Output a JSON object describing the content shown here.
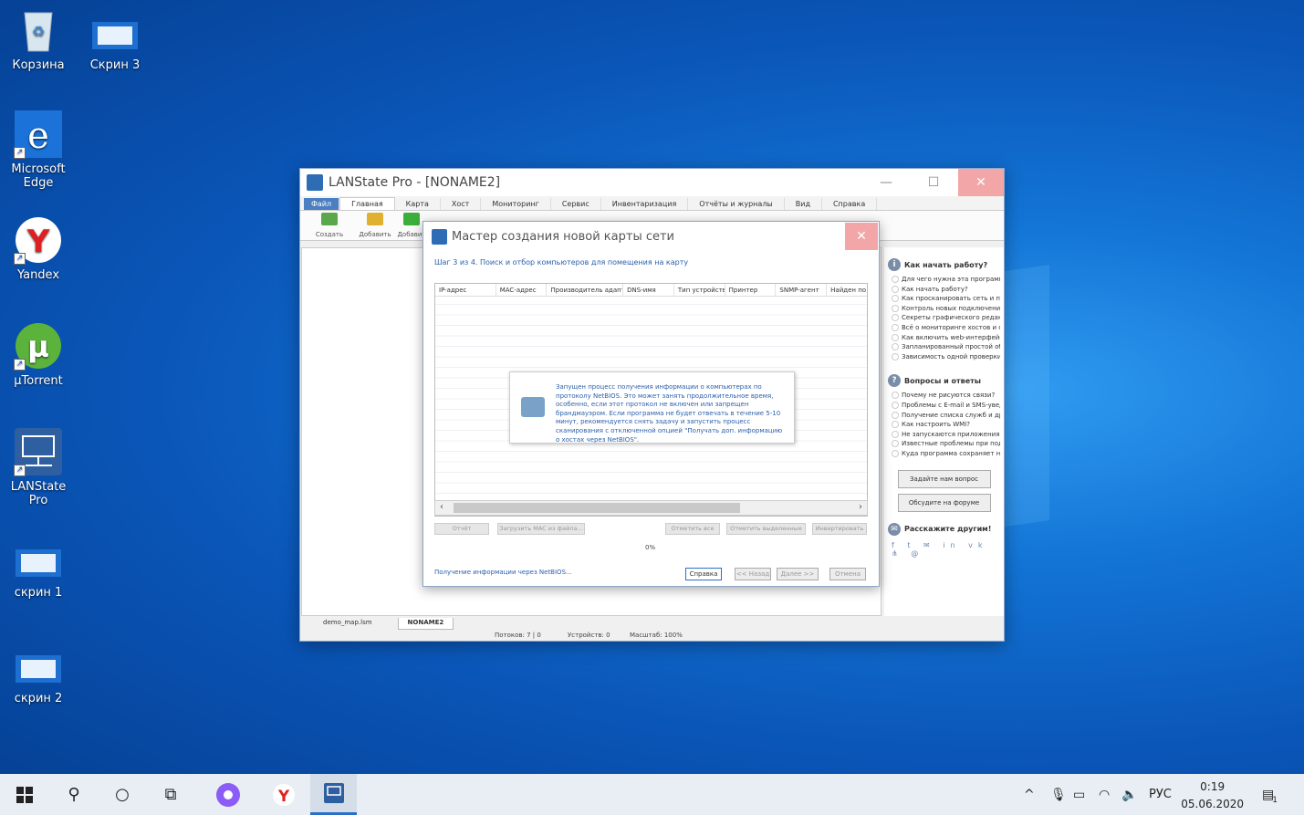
{
  "desktop": {
    "icons": [
      {
        "label": "Корзина",
        "icon": "recycle-bin-icon"
      },
      {
        "label": "Скрин 3",
        "icon": "image-file-icon"
      },
      {
        "label": "Microsoft Edge",
        "icon": "edge-icon"
      },
      {
        "label": "Yandex",
        "icon": "yandex-browser-icon"
      },
      {
        "label": "µTorrent",
        "icon": "utorrent-icon"
      },
      {
        "label": "LANState Pro",
        "icon": "lanstate-icon"
      },
      {
        "label": "скрин 1",
        "icon": "image-file-icon"
      },
      {
        "label": "скрин 2",
        "icon": "image-file-icon"
      }
    ]
  },
  "window": {
    "title": "LANState Pro - [NONAME2]",
    "menu": [
      "Файл",
      "Главная",
      "Карта",
      "Хост",
      "Мониторинг",
      "Сервис",
      "Инвентаризация",
      "Отчёты и журналы",
      "Вид",
      "Справка"
    ],
    "ribbon": [
      "Создать",
      "Добавить",
      "Добавит"
    ],
    "bottom_tabs": [
      "demo_map.lsm",
      "NONAME2"
    ],
    "status": {
      "threads": "Потоков: 7 | 0",
      "devices": "Устройств: 0",
      "scale": "Масштаб: 100%"
    }
  },
  "help": {
    "start_title": "Как начать работу?",
    "start_items": [
      "Для чего нужна эта программа?",
      "Как начать работу?",
      "Как просканировать сеть и постр...",
      "Контроль новых подключений к ...",
      "Секреты графического редактора",
      "Всё о мониторинге хостов и опов...",
      "Как включить web-интерфейс?",
      "Запланированный простой обор...",
      "Зависимость одной проверки от ..."
    ],
    "qa_title": "Вопросы и ответы",
    "qa_items": [
      "Почему не рисуются связи?",
      "Проблемы с E-mail и SMS-уведом...",
      "Получение списка служб и друго...",
      "Как настроить WMI?",
      "Не запускаются приложения из м...",
      "Известные проблемы при подкл...",
      "Куда программа сохраняет накоп..."
    ],
    "ask_button": "Задайте нам вопрос",
    "forum_button": "Обсудите на форуме",
    "share_title": "Расскажите другим!"
  },
  "wizard": {
    "title": "Мастер создания новой карты сети",
    "step": "Шаг 3 из 4. Поиск и отбор компьютеров для помещения на карту",
    "columns": [
      "IP-адрес",
      "MAC-адрес",
      "Производитель адаптера",
      "DNS-имя",
      "Тип устройства",
      "Принтер",
      "SNMP-агент",
      "Найден по..."
    ],
    "info_text": "Запущен процесс получения информации о компьютерах по протоколу NetBIOS. Это может занять продолжительное время, особенно, если этот протокол не включен или запрещен брандмауэром. Если программа не будет отвечать в течение 5-10 минут, рекомендуется снять задачу и запустить процесс сканирования с отключенной опцией \"Получать доп. информацию о хостах через NetBIOS\".",
    "grid_buttons": [
      "Отчёт",
      "Загрузить MAC из файла...",
      "Отметить все",
      "Отметить выделенные",
      "Инвертировать"
    ],
    "progress": "0%",
    "status_link": "Получение информации через NetBIOS...",
    "footer_buttons": [
      "Справка",
      "<< Назад",
      "Далее >>",
      "Отмена"
    ]
  },
  "taskbar": {
    "language": "РУС",
    "time": "0:19",
    "date": "05.06.2020",
    "notifications": "1"
  },
  "colors": {
    "accent": "#2a6fc6",
    "close": "#f2a6a8",
    "link": "#2a5fab"
  }
}
